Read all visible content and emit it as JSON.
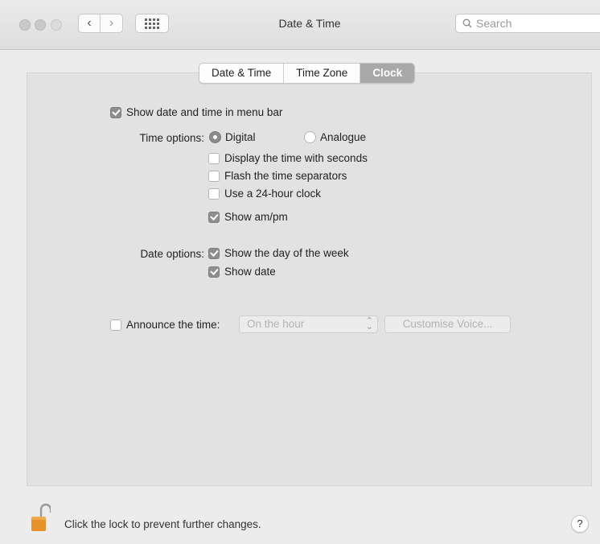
{
  "window": {
    "title": "Date & Time",
    "search_placeholder": "Search"
  },
  "tabs": [
    {
      "label": "Date & Time",
      "active": false
    },
    {
      "label": "Time Zone",
      "active": false
    },
    {
      "label": "Clock",
      "active": true
    }
  ],
  "clock": {
    "show_in_menu_bar": {
      "label": "Show date and time in menu bar",
      "checked": true
    },
    "time_options_label": "Time options:",
    "radio_digital": {
      "label": "Digital",
      "selected": true
    },
    "radio_analogue": {
      "label": "Analogue",
      "selected": false
    },
    "display_seconds": {
      "label": "Display the time with seconds",
      "checked": false
    },
    "flash_separators": {
      "label": "Flash the time separators",
      "checked": false
    },
    "use_24_hour": {
      "label": "Use a 24-hour clock",
      "checked": false
    },
    "show_ampm": {
      "label": "Show am/pm",
      "checked": true
    },
    "date_options_label": "Date options:",
    "show_day_of_week": {
      "label": "Show the day of the week",
      "checked": true
    },
    "show_date": {
      "label": "Show date",
      "checked": true
    },
    "announce_time": {
      "label": "Announce the time:",
      "checked": false
    },
    "announce_interval": "On the hour",
    "customise_voice": "Customise Voice..."
  },
  "footer": {
    "lock_text": "Click the lock to prevent further changes.",
    "help": "?"
  },
  "colors": {
    "active_tab": "#a9a9a9",
    "checked_box": "#8e8e8e",
    "lock": "#e8912a"
  }
}
